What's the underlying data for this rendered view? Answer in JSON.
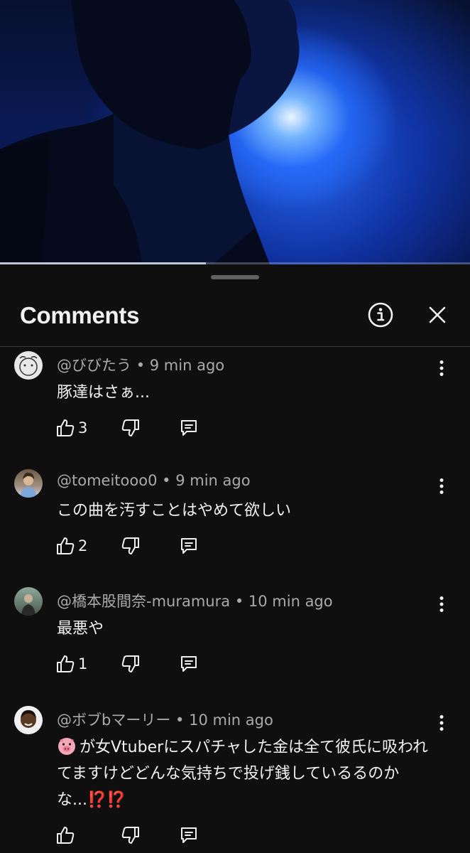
{
  "player": {
    "progress": 0.4375
  },
  "panel": {
    "title": "Comments",
    "info_icon": "info-icon",
    "close_icon": "close-icon"
  },
  "comments": [
    {
      "author": "@びびたう",
      "time": "9 min ago",
      "text": "豚達はさぁ...",
      "likes": "3"
    },
    {
      "author": "@tomeitooo0",
      "time": "9 min ago",
      "text": "この曲を汚すことはやめて欲しい",
      "likes": "2"
    },
    {
      "author": "@橋本股間奈-muramura",
      "time": "10 min ago",
      "text": "最悪や",
      "likes": "1"
    },
    {
      "author": "@ボブbマーリー",
      "time": "10 min ago",
      "text_emoji": "pig-face-emoji",
      "text": "が女Vtuberにスパチャした金は全て彼氏に吸われてますけどどんな気持ちで投げ銭しているるのかな...",
      "text_suffix": "⁉️⁉️",
      "likes": ""
    }
  ],
  "separator": "•",
  "colors": {
    "background": "#0f0f0f",
    "meta": "#aaaaaa",
    "text": "#f1f1f1",
    "divider": "#3a3a3a"
  }
}
